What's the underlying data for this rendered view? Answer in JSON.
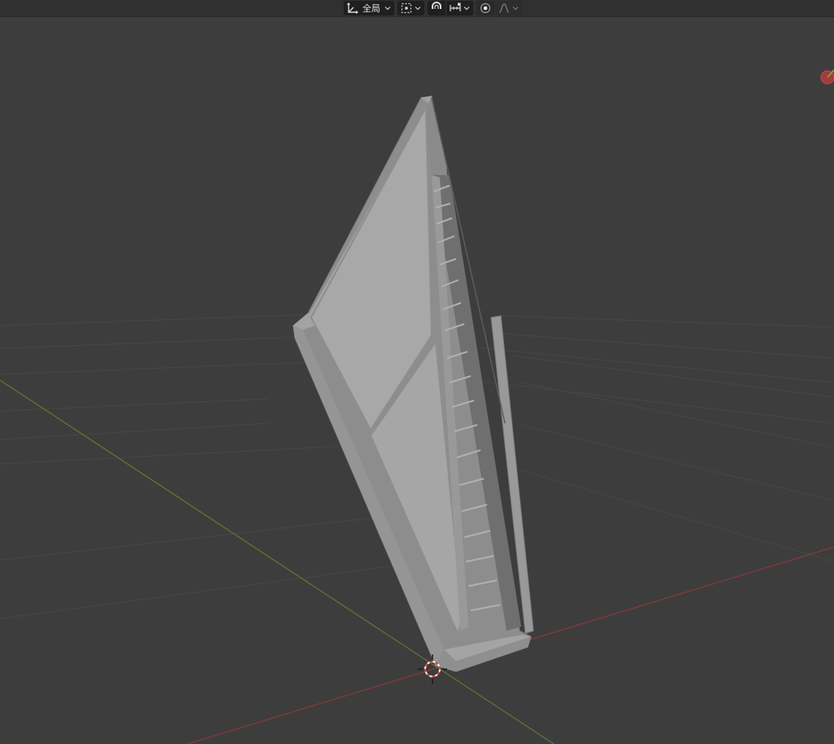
{
  "header": {
    "toolbar": {
      "transform_pivot": {
        "icon": "transform-pivot-icon",
        "label": "全局"
      },
      "snap": {
        "icon": "snap-target-icon"
      },
      "proportional": {
        "icon": "proportional-editing-icon"
      },
      "falloff": {
        "icon": "falloff-curve-icon"
      }
    }
  },
  "viewport": {
    "gizmo": {
      "icon": "navigation-gizmo-x-axis-icon"
    },
    "cursor": {
      "icon": "3d-cursor-icon"
    },
    "colors": {
      "background": "#3d3d3d",
      "grid": "#4a4a4a",
      "x_axis": "#8a3a3a",
      "y_axis": "#5e7a2e",
      "mesh": "#9c9c9c"
    }
  }
}
